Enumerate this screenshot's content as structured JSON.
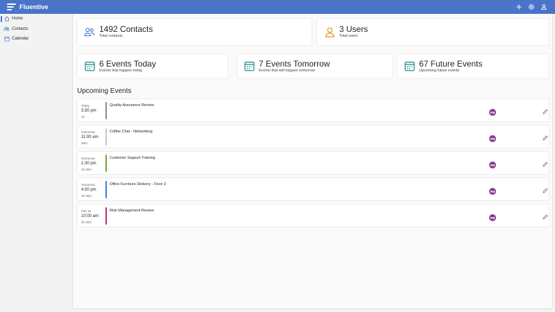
{
  "app": {
    "name": "Fluentive"
  },
  "topbar": {
    "actions": [
      {
        "icon": "add-icon"
      },
      {
        "icon": "settings-icon"
      },
      {
        "icon": "account-icon"
      }
    ]
  },
  "sidebar": {
    "items": [
      {
        "label": "Home",
        "icon": "home-icon",
        "active": true
      },
      {
        "label": "Contacts",
        "icon": "contacts-icon",
        "active": false
      },
      {
        "label": "Calendar",
        "icon": "calendar-icon",
        "active": false
      }
    ]
  },
  "stats": {
    "contacts": {
      "title": "1492 Contacts",
      "subtitle": "Total contacts",
      "icon": "contacts-icon"
    },
    "users": {
      "title": "3 Users",
      "subtitle": "Total users",
      "icon": "user-icon"
    },
    "today": {
      "title": "6 Events Today",
      "subtitle": "Events that happen today",
      "icon": "calendar-icon"
    },
    "tomorrow": {
      "title": "7 Events Tomorrow",
      "subtitle": "Events that will happen tomorrow",
      "icon": "calendar-icon"
    },
    "future": {
      "title": "67 Future Events",
      "subtitle": "Upcoming future events",
      "icon": "calendar-icon"
    }
  },
  "upcoming": {
    "title": "Upcoming Events",
    "events": [
      {
        "day": "Today",
        "time": "3:30 pm",
        "duration": "1h",
        "title": "Quality Assurance Review",
        "color": "#8a8a8a",
        "avatar": "PM"
      },
      {
        "day": "Tomorrow",
        "time": "11:00 am",
        "duration": "30m",
        "title": "Coffee Chat - Networking",
        "color": "#c8c8c8",
        "avatar": "PM"
      },
      {
        "day": "Tomorrow",
        "time": "1:30 pm",
        "duration": "1h 30m",
        "title": "Customer Support Training",
        "color": "#6aaa2c",
        "avatar": "PM"
      },
      {
        "day": "Tomorrow",
        "time": "4:30 pm",
        "duration": "1h 30m",
        "title": "Office Furniture Delivery - Floor 2",
        "color": "#3a7bd5",
        "avatar": "PM"
      },
      {
        "day": "Feb 15",
        "time": "10:00 am",
        "duration": "1h 30m",
        "title": "Risk Management Review",
        "color": "#b4287a",
        "avatar": "PM"
      }
    ]
  },
  "colors": {
    "brand": "#4a74c8",
    "accent_blue": "#3a6fc4",
    "accent_gold": "#d99a1e",
    "accent_teal": "#0f8484",
    "avatar": "#8a3c90"
  }
}
